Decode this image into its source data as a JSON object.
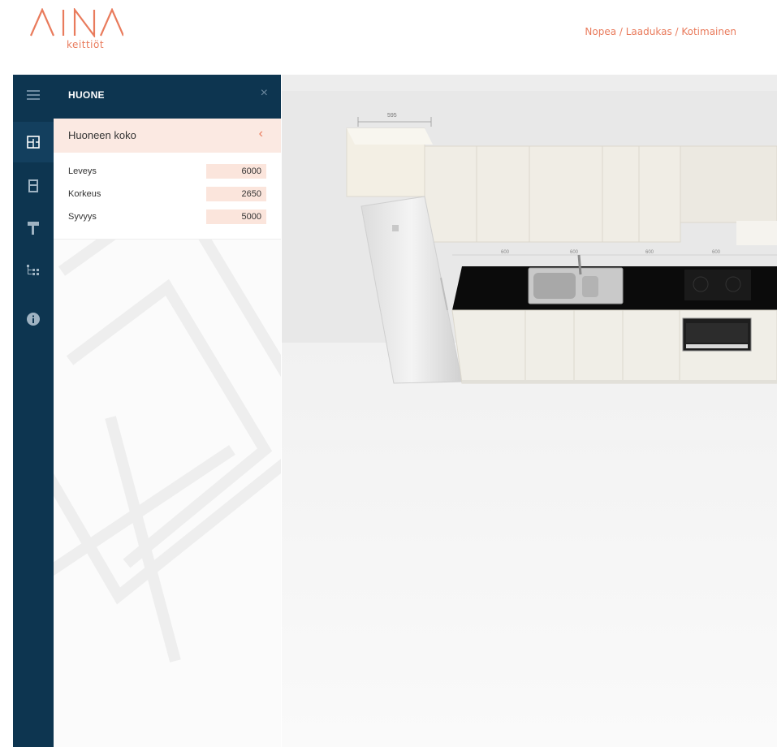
{
  "header": {
    "logo_sub": "keittiöt",
    "tagline": "Nopea / Laadukas / Kotimainen",
    "accent": "#e97b5c"
  },
  "rail": {
    "items": [
      {
        "icon": "menu-icon"
      },
      {
        "icon": "floorplan-icon"
      },
      {
        "icon": "cabinet-icon"
      },
      {
        "icon": "paint-roller-icon"
      },
      {
        "icon": "hierarchy-icon"
      },
      {
        "icon": "info-icon"
      }
    ],
    "color": "#0d3550"
  },
  "panel": {
    "title": "HUONE",
    "close": "×",
    "section": {
      "title": "Huoneen koko",
      "chevron": "‹"
    },
    "fields": [
      {
        "label": "Leveys",
        "value": "6000"
      },
      {
        "label": "Korkeus",
        "value": "2650"
      },
      {
        "label": "Syvyys",
        "value": "5000"
      }
    ]
  },
  "canvas": {
    "dimension_labels": [
      "595",
      "600",
      "600",
      "600",
      "600"
    ]
  }
}
